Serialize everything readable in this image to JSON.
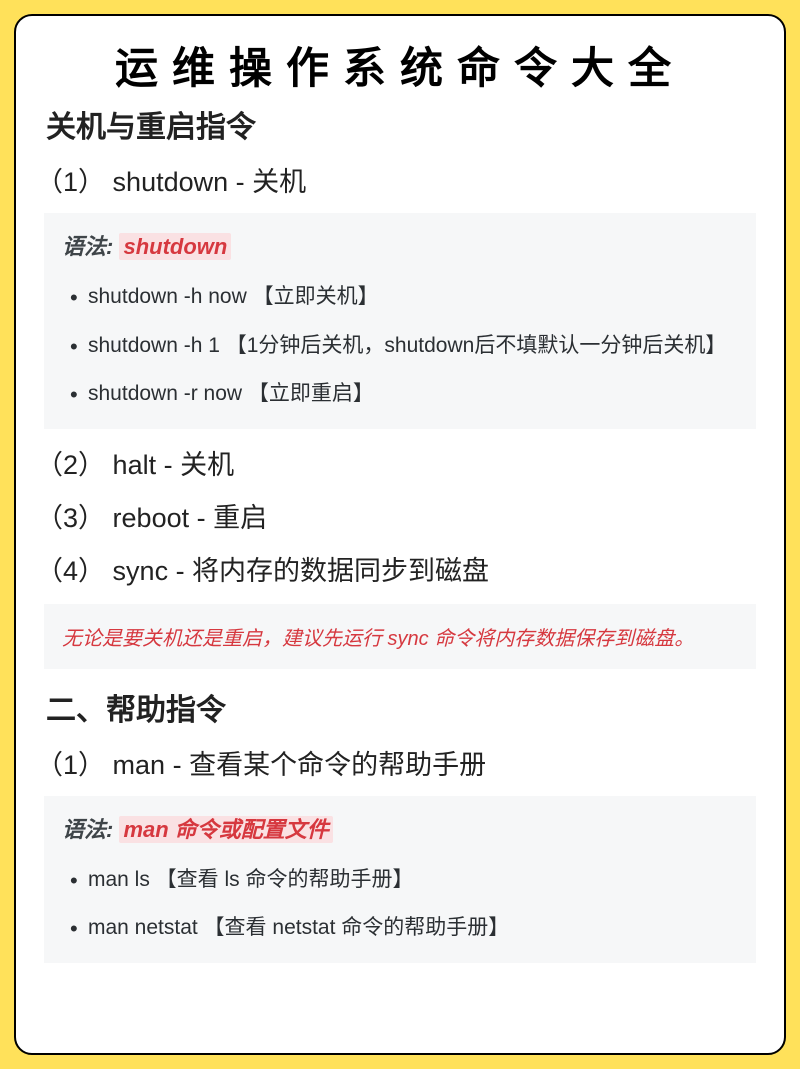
{
  "title": "运维操作系统命令大全",
  "section1": {
    "heading": "关机与重启指令",
    "items": [
      {
        "num": "（1）",
        "text": "shutdown - 关机"
      },
      {
        "num": "（2）",
        "text": "halt - 关机"
      },
      {
        "num": "（3）",
        "text": "reboot - 重启"
      },
      {
        "num": "（4）",
        "text": "sync - 将内存的数据同步到磁盘"
      }
    ],
    "syntax": {
      "label": "语法:",
      "cmd": "shutdown",
      "examples": [
        "shutdown -h now 【立即关机】",
        "shutdown -h 1 【1分钟后关机，shutdown后不填默认一分钟后关机】",
        "shutdown -r now 【立即重启】"
      ]
    },
    "note": "无论是要关机还是重启，建议先运行 sync 命令将内存数据保存到磁盘。"
  },
  "section2": {
    "heading": "二、帮助指令",
    "items": [
      {
        "num": "（1）",
        "text": "man - 查看某个命令的帮助手册"
      }
    ],
    "syntax": {
      "label": "语法:",
      "cmd": "man 命令或配置文件",
      "examples": [
        "man ls 【查看 ls 命令的帮助手册】",
        "man netstat 【查看 netstat 命令的帮助手册】"
      ]
    }
  }
}
